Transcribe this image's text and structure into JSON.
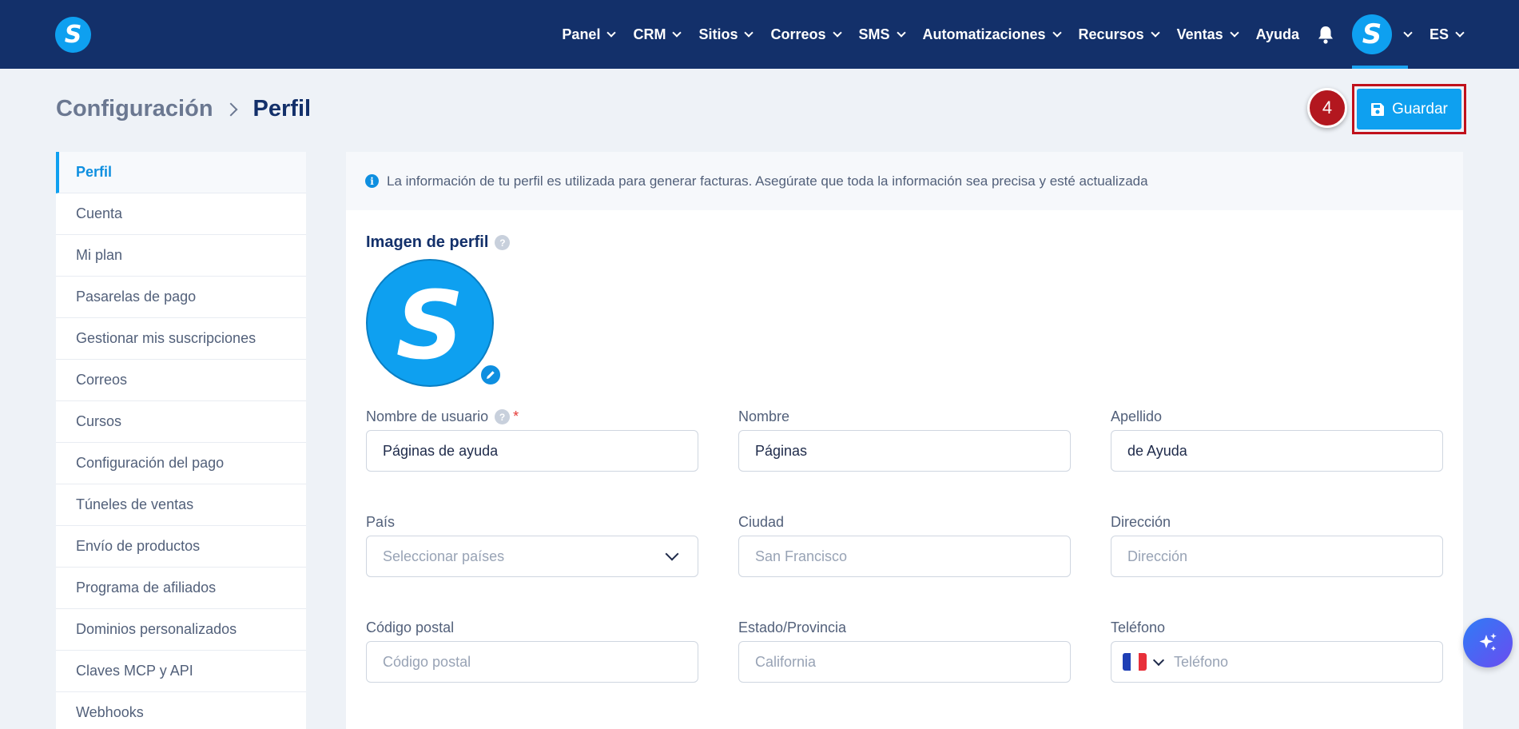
{
  "app": {
    "logo_letter": "S"
  },
  "nav": {
    "items": [
      {
        "label": "Panel",
        "has_menu": true
      },
      {
        "label": "CRM",
        "has_menu": true
      },
      {
        "label": "Sitios",
        "has_menu": true
      },
      {
        "label": "Correos",
        "has_menu": true
      },
      {
        "label": "SMS",
        "has_menu": true
      },
      {
        "label": "Automatizaciones",
        "has_menu": true
      },
      {
        "label": "Recursos",
        "has_menu": true
      },
      {
        "label": "Ventas",
        "has_menu": true
      },
      {
        "label": "Ayuda",
        "has_menu": false
      }
    ],
    "avatar_letter": "S",
    "language": "ES"
  },
  "header": {
    "breadcrumb_parent": "Configuración",
    "breadcrumb_current": "Perfil",
    "step_number": "4",
    "save_label": "Guardar"
  },
  "sidebar": {
    "items": [
      {
        "label": "Perfil",
        "active": true
      },
      {
        "label": "Cuenta"
      },
      {
        "label": "Mi plan"
      },
      {
        "label": "Pasarelas de pago"
      },
      {
        "label": "Gestionar mis suscripciones"
      },
      {
        "label": "Correos"
      },
      {
        "label": "Cursos"
      },
      {
        "label": "Configuración del pago"
      },
      {
        "label": "Túneles de ventas"
      },
      {
        "label": "Envío de productos"
      },
      {
        "label": "Programa de afiliados"
      },
      {
        "label": "Dominios personalizados"
      },
      {
        "label": "Claves MCP y API"
      },
      {
        "label": "Webhooks"
      }
    ]
  },
  "main": {
    "info_text": "La información de tu perfil es utilizada para generar facturas. Asegúrate que toda la información sea precisa y esté actualizada",
    "info_icon": "i",
    "help_glyph": "?",
    "required_mark": "*",
    "profile_image_title": "Imagen de perfil",
    "profile_letter": "S",
    "fields": {
      "username": {
        "label": "Nombre de usuario",
        "value": "Páginas de ayuda",
        "required": true
      },
      "first_name": {
        "label": "Nombre",
        "value": "Páginas"
      },
      "last_name": {
        "label": "Apellido",
        "value": "de Ayuda"
      },
      "country": {
        "label": "País",
        "placeholder": "Seleccionar países"
      },
      "city": {
        "label": "Ciudad",
        "placeholder": "San Francisco"
      },
      "address": {
        "label": "Dirección",
        "placeholder": "Dirección"
      },
      "postal_code": {
        "label": "Código postal",
        "placeholder": "Código postal"
      },
      "state": {
        "label": "Estado/Provincia",
        "placeholder": "California"
      },
      "phone": {
        "label": "Teléfono",
        "placeholder": "Teléfono",
        "flag_colors": [
          "#1f3fb5",
          "#ffffff",
          "#e8303a"
        ]
      }
    }
  },
  "colors": {
    "nav_bg": "#13306a",
    "accent": "#0ea0f0",
    "badge": "#b3171f",
    "outline": "#c0111c"
  }
}
